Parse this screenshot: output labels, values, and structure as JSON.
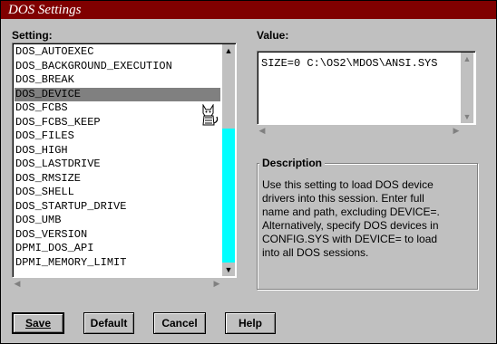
{
  "window": {
    "title": "DOS Settings"
  },
  "setting_label": "Setting:",
  "value_label": "Value:",
  "settings_list": {
    "items": [
      "DOS_AUTOEXEC",
      "DOS_BACKGROUND_EXECUTION",
      "DOS_BREAK",
      "DOS_DEVICE",
      "DOS_FCBS",
      "DOS_FCBS_KEEP",
      "DOS_FILES",
      "DOS_HIGH",
      "DOS_LASTDRIVE",
      "DOS_RMSIZE",
      "DOS_SHELL",
      "DOS_STARTUP_DRIVE",
      "DOS_UMB",
      "DOS_VERSION",
      "DPMI_DOS_API",
      "DPMI_MEMORY_LIMIT"
    ],
    "selected": "DOS_DEVICE"
  },
  "value_field": {
    "value": "SIZE=0 C:\\OS2\\MDOS\\ANSI.SYS"
  },
  "description": {
    "title": "Description",
    "lines": [
      "Use this setting to load DOS device",
      "drivers into this session. Enter full",
      "name and path, excluding DEVICE=.",
      "Alternatively, specify DOS devices in",
      "CONFIG.SYS with DEVICE= to load",
      "into all DOS sessions."
    ]
  },
  "buttons": {
    "save": "Save",
    "default": "Default",
    "cancel": "Cancel",
    "help": "Help"
  },
  "colors": {
    "title_bar": "#800000",
    "window": "#c0c0c0",
    "thumb": "#00ffff",
    "selection": "#808080"
  }
}
